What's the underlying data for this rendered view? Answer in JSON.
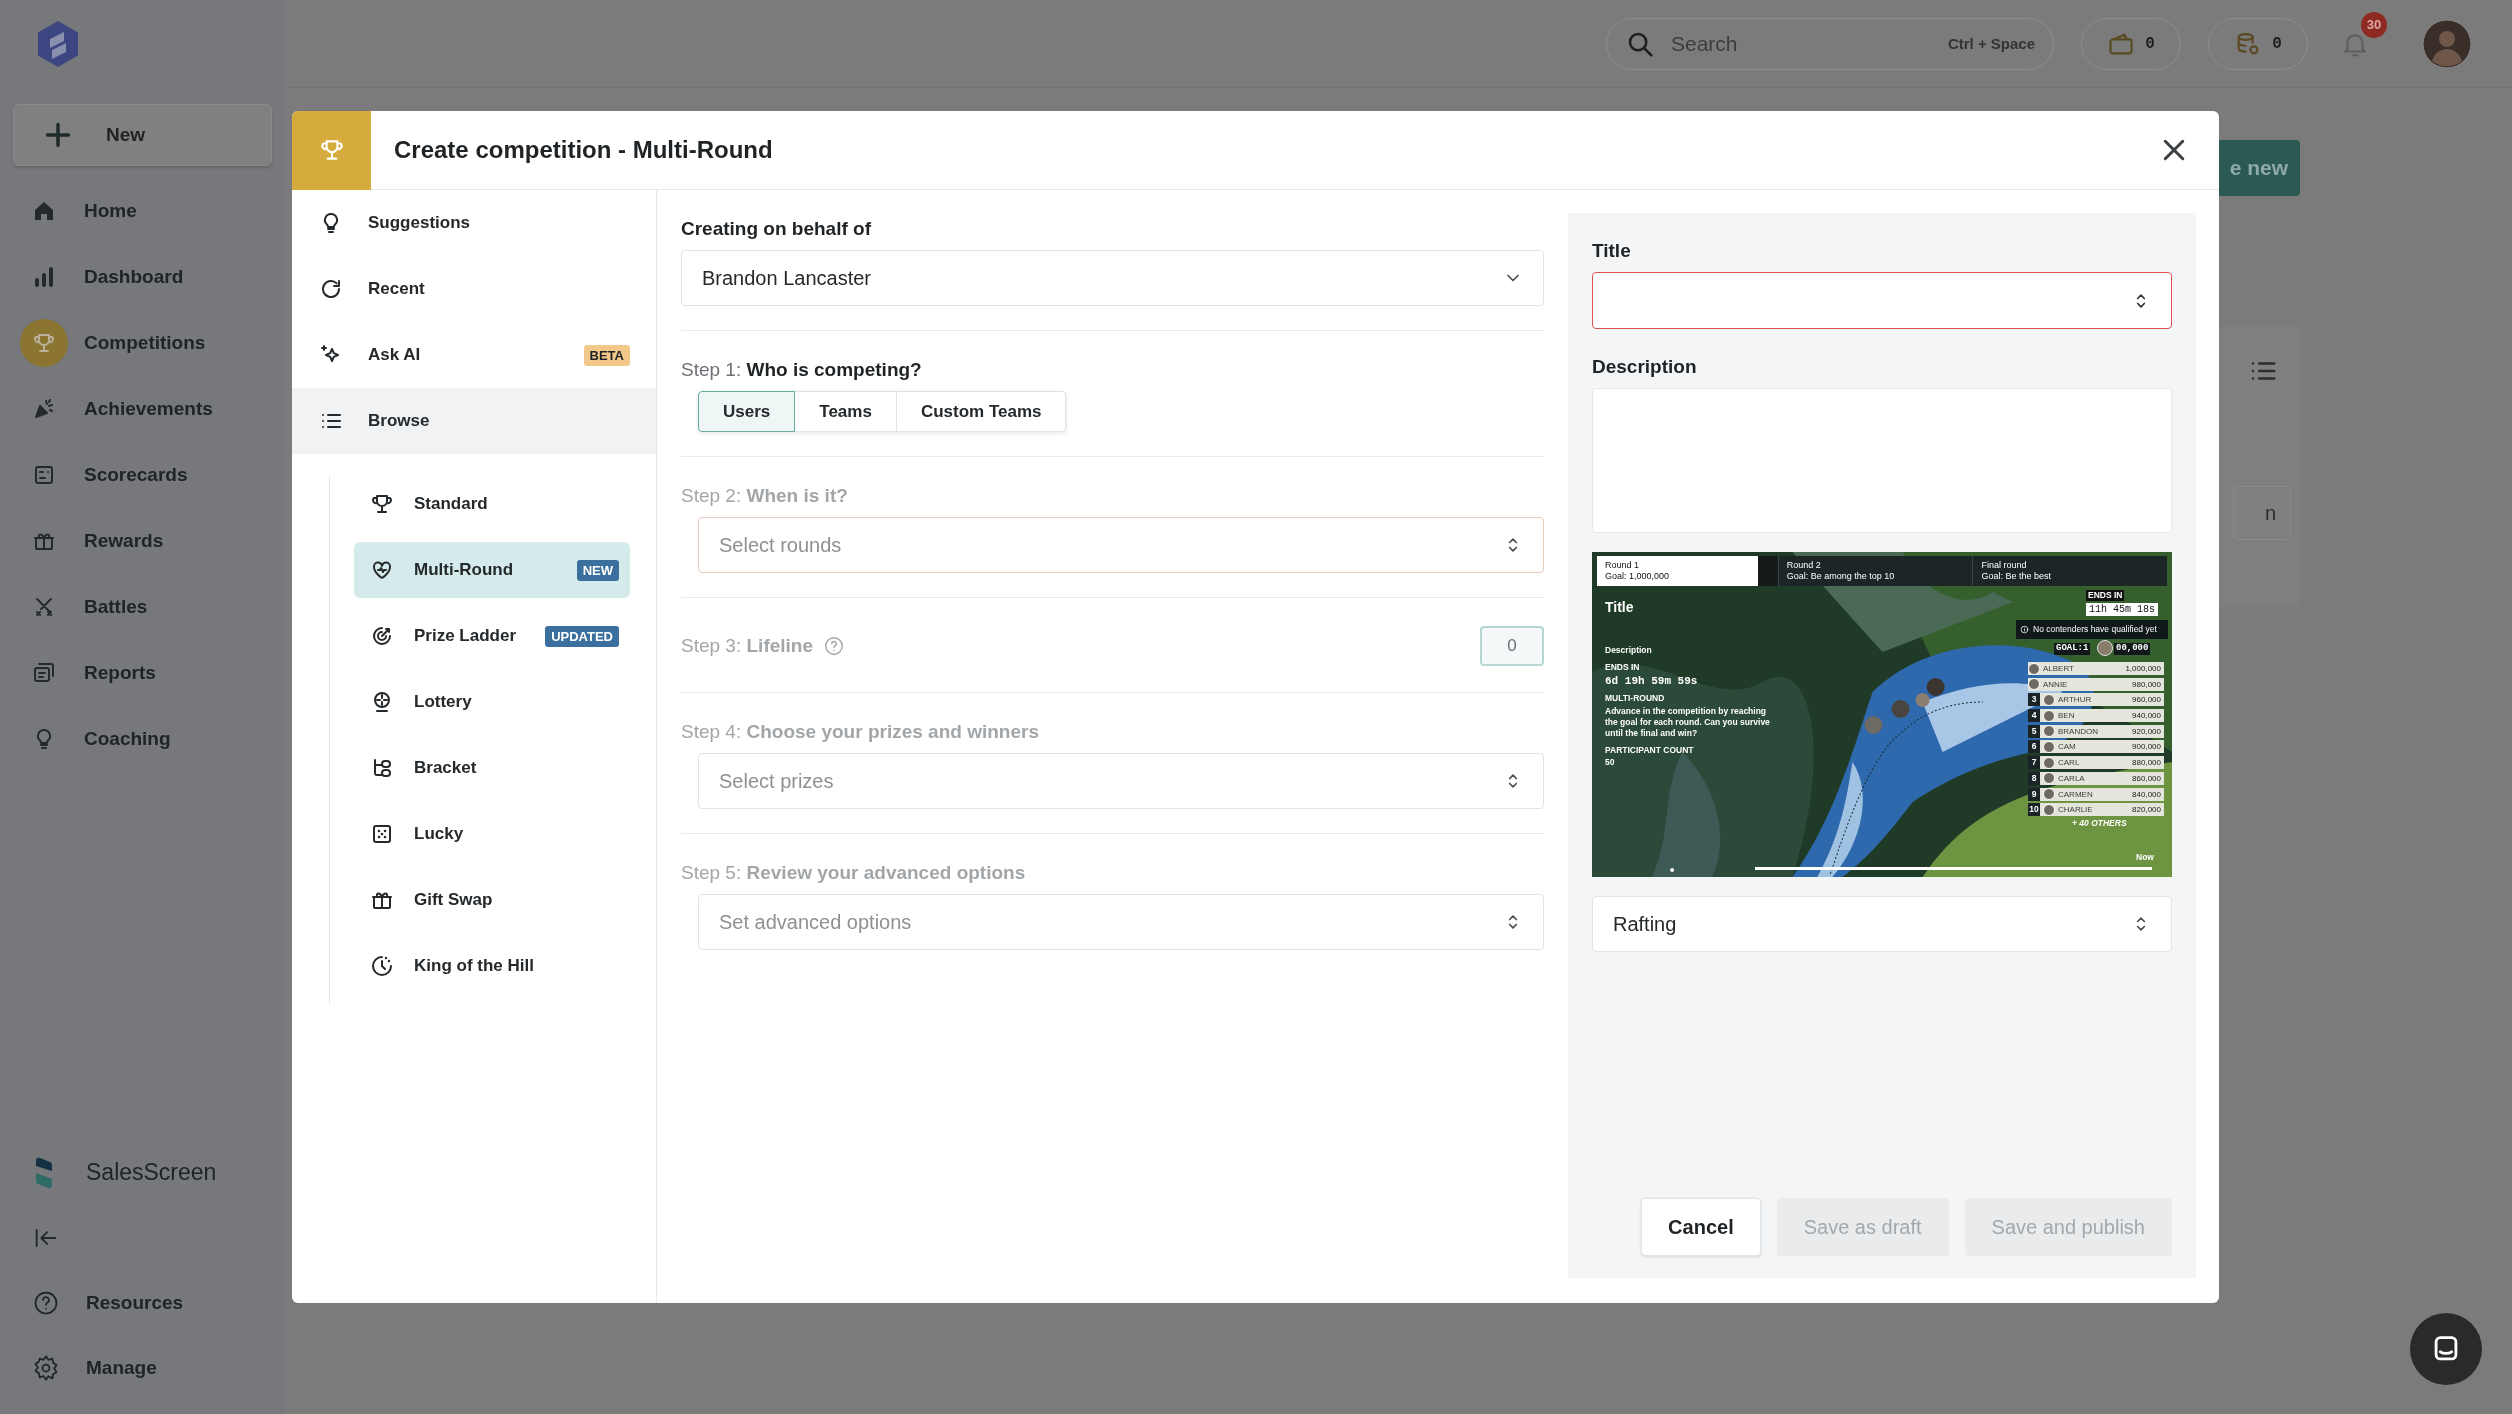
{
  "topbar": {
    "search": {
      "placeholder": "Search",
      "shortcut": "Ctrl + Space"
    },
    "wallet": "0",
    "coins": "0",
    "notifications": "30"
  },
  "sidebar": {
    "new_label": "New",
    "items": [
      {
        "label": "Home",
        "selected": false
      },
      {
        "label": "Dashboard",
        "selected": false
      },
      {
        "label": "Competitions",
        "selected": true
      },
      {
        "label": "Achievements",
        "selected": false
      },
      {
        "label": "Scorecards",
        "selected": false
      },
      {
        "label": "Rewards",
        "selected": false
      },
      {
        "label": "Battles",
        "selected": false
      },
      {
        "label": "Reports",
        "selected": false
      },
      {
        "label": "Coaching",
        "selected": false
      }
    ],
    "brand": "SalesScreen",
    "footer": [
      {
        "label": "Resources"
      },
      {
        "label": "Manage"
      }
    ]
  },
  "page": {
    "button": "e new",
    "card_text": "n"
  },
  "modal": {
    "title": "Create competition - Multi-Round",
    "nav": [
      {
        "label": "Suggestions",
        "selected": false
      },
      {
        "label": "Recent",
        "selected": false
      },
      {
        "label": "Ask AI",
        "selected": false,
        "badge": {
          "text": "BETA",
          "color": "#f2c98a"
        }
      },
      {
        "label": "Browse",
        "selected": true,
        "expanded": true,
        "children": [
          {
            "label": "Standard",
            "selected": false
          },
          {
            "label": "Multi-Round",
            "selected": true,
            "badge": {
              "text": "NEW",
              "color": "#3b6f9e"
            }
          },
          {
            "label": "Prize Ladder",
            "selected": false,
            "badge": {
              "text": "UPDATED",
              "color": "#3b6f9e"
            }
          },
          {
            "label": "Lottery",
            "selected": false
          },
          {
            "label": "Bracket",
            "selected": false
          },
          {
            "label": "Lucky",
            "selected": false
          },
          {
            "label": "Gift Swap",
            "selected": false
          },
          {
            "label": "King of the Hill",
            "selected": false
          }
        ]
      }
    ],
    "behalf": {
      "label": "Creating on behalf of",
      "value": "Brandon Lancaster"
    },
    "steps": [
      {
        "kind": "segmented",
        "text": "Step 1: **Who is competing?**",
        "disabled": false,
        "options": [
          {
            "label": "Users",
            "selected": true
          },
          {
            "label": "Teams",
            "selected": false
          },
          {
            "label": "Custom Teams",
            "selected": false
          }
        ]
      },
      {
        "kind": "select",
        "text": "Step 2: **When is it?**",
        "disabled": true,
        "placeholder": "Select rounds",
        "highlighted": true
      },
      {
        "kind": "number",
        "text": "Step 3: **Lifeline**",
        "disabled": true,
        "help": true,
        "value": "0"
      },
      {
        "kind": "select",
        "text": "Step 4: **Choose your prizes and winners**",
        "disabled": true,
        "placeholder": "Select prizes",
        "highlighted": false
      },
      {
        "kind": "select",
        "text": "Step 5: **Review your advanced options**",
        "disabled": true,
        "placeholder": "Set advanced options",
        "highlighted": false
      }
    ],
    "side": {
      "title_label": "Title",
      "title_invalid": true,
      "description_label": "Description",
      "preview": {
        "kind": "picture",
        "rounds": [
          {
            "name": "Round 1",
            "goal": "Goal: 1,000,000",
            "selected": true
          },
          {
            "name": "Round 2",
            "goal": "Goal: Be among the top 10",
            "selected": false
          },
          {
            "name": "Final round",
            "goal": "Goal: Be the best",
            "selected": false
          }
        ],
        "title": "Title",
        "description": "Description",
        "ends_label": "ENDS IN",
        "ends_value": "6d 19h 59m 59s",
        "mode_label": "MULTI-ROUND",
        "mode_text": "Advance in the competition by reaching the goal for each round. Can you survive until the final and win?",
        "count_label": "PARTICIPANT COUNT",
        "count_value": "50",
        "timer_label": "ENDS IN",
        "timer_value": "11h 45m 18s",
        "notice": "No contenders have qualified yet",
        "goal_label": "GOAL:1",
        "goal_value": "00,000",
        "leaders": [
          {
            "name": "ALBERT",
            "score": "1,000,000"
          },
          {
            "name": "ANNIE",
            "score": "980,000"
          },
          {
            "rank": "3",
            "name": "ARTHUR",
            "score": "960,000"
          },
          {
            "rank": "4",
            "name": "BEN",
            "score": "940,000"
          },
          {
            "rank": "5",
            "name": "BRANDON",
            "score": "920,000"
          },
          {
            "rank": "6",
            "name": "CAM",
            "score": "900,000"
          },
          {
            "rank": "7",
            "name": "CARL",
            "score": "880,000"
          },
          {
            "rank": "8",
            "name": "CARLA",
            "score": "860,000"
          },
          {
            "rank": "9",
            "name": "CARMEN",
            "score": "840,000"
          },
          {
            "rank": "10",
            "name": "CHARLIE",
            "score": "820,000"
          }
        ],
        "others": "+ 40 OTHERS",
        "now": "Now"
      },
      "theme": "Rafting",
      "buttons": [
        {
          "label": "Cancel",
          "disabled": false
        },
        {
          "label": "Save as draft",
          "disabled": true
        },
        {
          "label": "Save and publish",
          "disabled": true
        }
      ]
    }
  }
}
